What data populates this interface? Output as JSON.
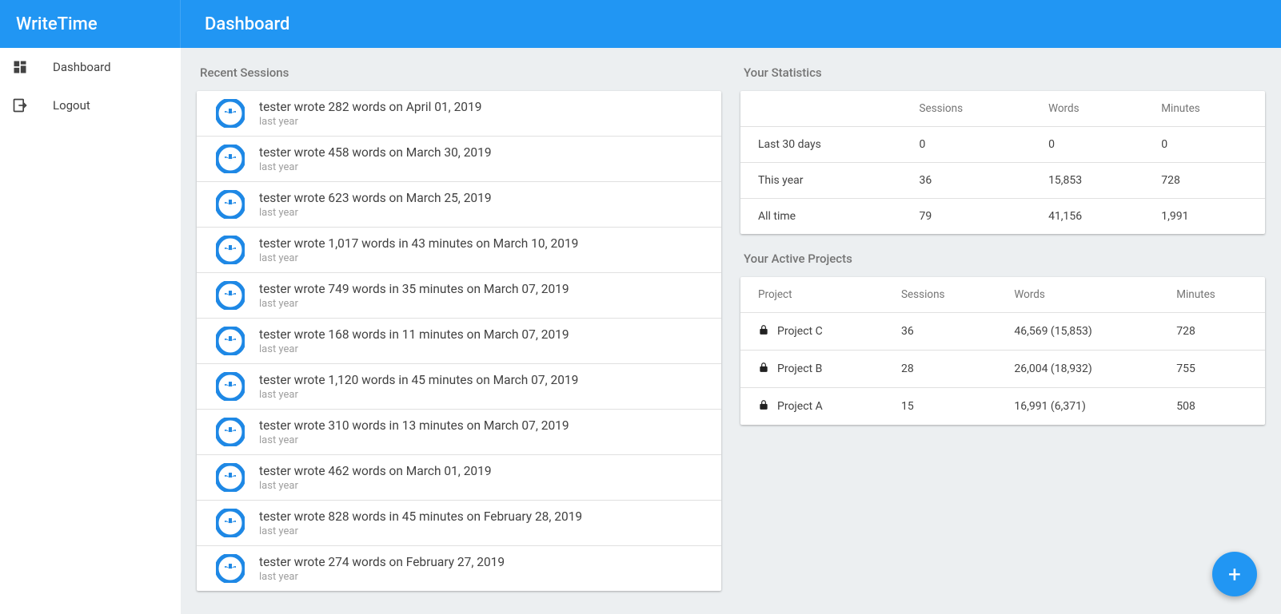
{
  "header": {
    "logo": "WriteTime",
    "title": "Dashboard"
  },
  "sidebar": {
    "items": [
      {
        "label": "Dashboard",
        "icon": "dashboard-icon"
      },
      {
        "label": "Logout",
        "icon": "logout-icon"
      }
    ]
  },
  "sessions": {
    "title": "Recent Sessions",
    "items": [
      {
        "line": "tester wrote 282 words on April 01, 2019",
        "ago": "last year"
      },
      {
        "line": "tester wrote 458 words on March 30, 2019",
        "ago": "last year"
      },
      {
        "line": "tester wrote 623 words on March 25, 2019",
        "ago": "last year"
      },
      {
        "line": "tester wrote 1,017 words in 43 minutes on March 10, 2019",
        "ago": "last year"
      },
      {
        "line": "tester wrote 749 words in 35 minutes on March 07, 2019",
        "ago": "last year"
      },
      {
        "line": "tester wrote 168 words in 11 minutes on March 07, 2019",
        "ago": "last year"
      },
      {
        "line": "tester wrote 1,120 words in 45 minutes on March 07, 2019",
        "ago": "last year"
      },
      {
        "line": "tester wrote 310 words in 13 minutes on March 07, 2019",
        "ago": "last year"
      },
      {
        "line": "tester wrote 462 words on March 01, 2019",
        "ago": "last year"
      },
      {
        "line": "tester wrote 828 words in 45 minutes on February 28, 2019",
        "ago": "last year"
      },
      {
        "line": "tester wrote 274 words on February 27, 2019",
        "ago": "last year"
      }
    ]
  },
  "stats": {
    "title": "Your Statistics",
    "headers": {
      "sessions": "Sessions",
      "words": "Words",
      "minutes": "Minutes"
    },
    "rows": [
      {
        "label": "Last 30 days",
        "sessions": "0",
        "words": "0",
        "minutes": "0"
      },
      {
        "label": "This year",
        "sessions": "36",
        "words": "15,853",
        "minutes": "728"
      },
      {
        "label": "All time",
        "sessions": "79",
        "words": "41,156",
        "minutes": "1,991"
      }
    ]
  },
  "projects": {
    "title": "Your Active Projects",
    "headers": {
      "project": "Project",
      "sessions": "Sessions",
      "words": "Words",
      "minutes": "Minutes"
    },
    "rows": [
      {
        "name": "Project C",
        "sessions": "36",
        "words": "46,569  (15,853)",
        "minutes": "728"
      },
      {
        "name": "Project B",
        "sessions": "28",
        "words": "26,004  (18,932)",
        "minutes": "755"
      },
      {
        "name": "Project A",
        "sessions": "15",
        "words": "16,991  (6,371)",
        "minutes": "508"
      }
    ]
  },
  "fab": {
    "label": "+"
  }
}
